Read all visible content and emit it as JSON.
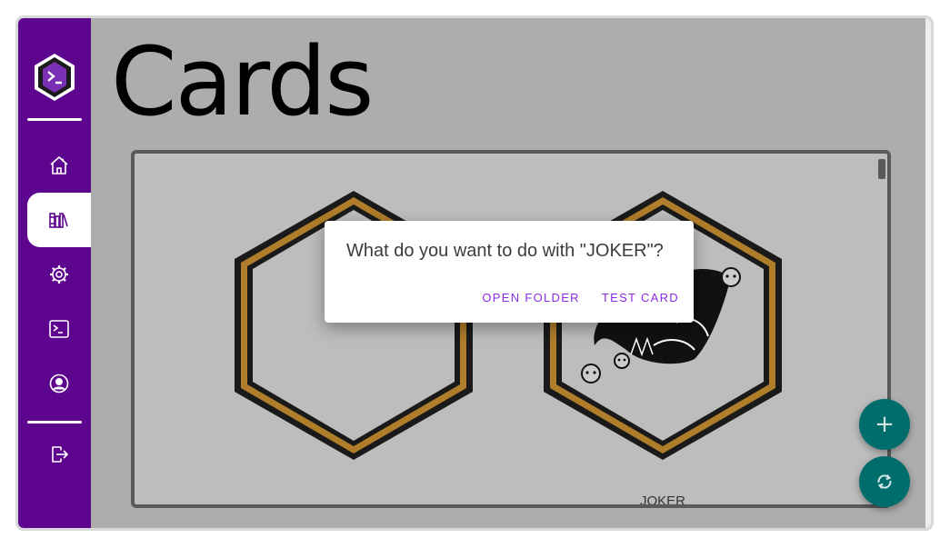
{
  "page": {
    "title": "Cards"
  },
  "sidebar": {
    "items": [
      {
        "name": "home",
        "icon": "home-icon"
      },
      {
        "name": "library",
        "icon": "library-icon",
        "active": true
      },
      {
        "name": "settings",
        "icon": "gear-icon"
      },
      {
        "name": "terminal",
        "icon": "terminal-icon"
      },
      {
        "name": "profile",
        "icon": "account-circle-icon"
      },
      {
        "name": "logout",
        "icon": "logout-icon"
      }
    ]
  },
  "cards": [
    {
      "label": "",
      "icon": "hexagon-card-blank"
    },
    {
      "label": "JOKER",
      "icon": "jester-hat-icon"
    }
  ],
  "dialog": {
    "message": "What do you want to do with \"JOKER\"?",
    "open_folder_label": "OPEN FOLDER",
    "test_card_label": "TEST CARD"
  },
  "fabs": {
    "add_label": "+",
    "refresh_icon": "refresh-icon"
  },
  "colors": {
    "sidebar": "#5e0590",
    "background": "#adadad",
    "card_gold": "#b07d2a",
    "accent": "#8a2be2",
    "fab": "#006d6d"
  }
}
